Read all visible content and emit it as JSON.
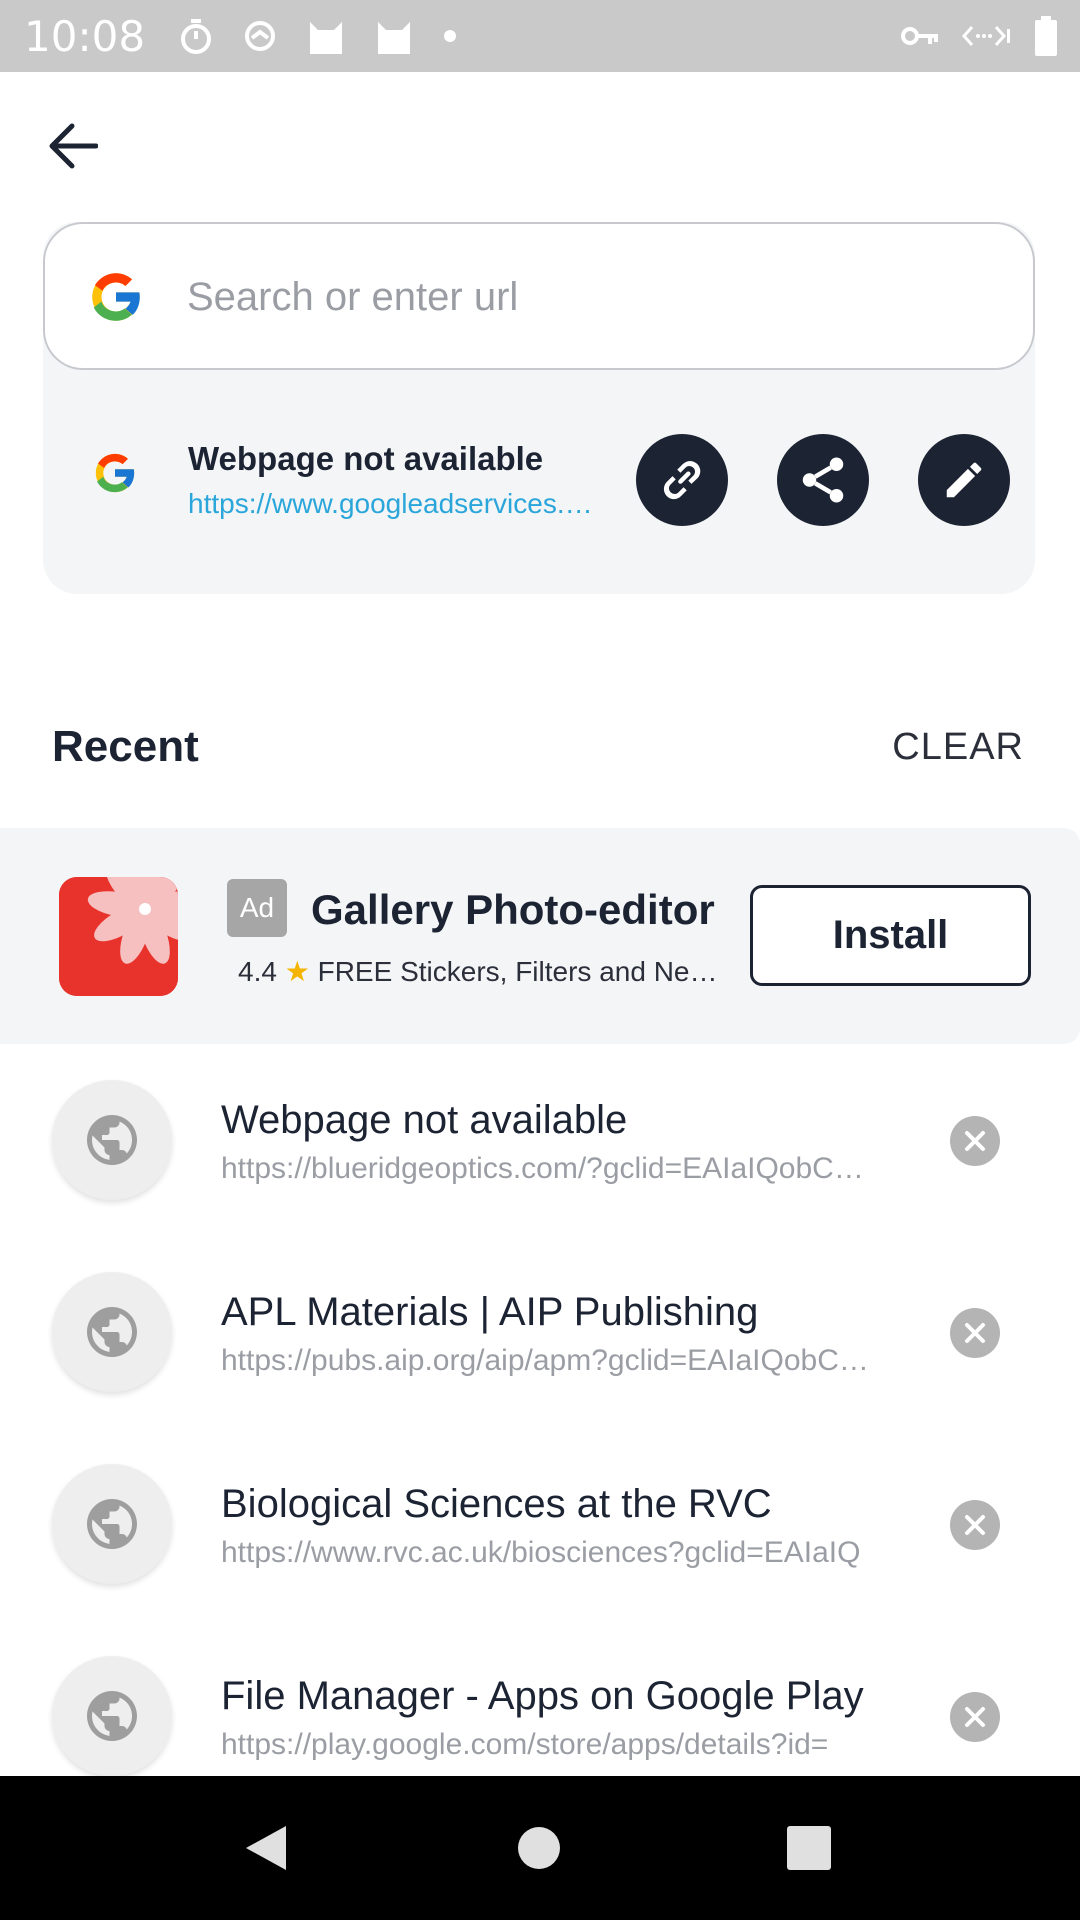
{
  "status_bar": {
    "time": "10:08",
    "left_icons": [
      "timer-icon",
      "sync-icon",
      "cat-icon",
      "cat-icon",
      "dot-icon"
    ],
    "right_icons": [
      "vpn-key-icon",
      "data-arrows-icon",
      "battery-icon"
    ]
  },
  "header": {
    "back_icon": "arrow-left-icon"
  },
  "search": {
    "placeholder": "Search or enter url",
    "value": ""
  },
  "current_page": {
    "title": "Webpage not available",
    "url": "https://www.googleadservices.com/pagead/aclk",
    "actions": [
      "link-icon",
      "share-icon",
      "edit-icon"
    ]
  },
  "recent": {
    "title": "Recent",
    "clear_label": "CLEAR"
  },
  "ad": {
    "badge": "Ad",
    "title": "Gallery Photo-editor",
    "rating": "4.4",
    "subtitle": "FREE Stickers, Filters and New Features",
    "install_label": "Install"
  },
  "recent_items": [
    {
      "title": "Webpage not available",
      "url": "https://blueridgeoptics.com/?gclid=EAIaIQobChMI"
    },
    {
      "title": "APL Materials | AIP Publishing",
      "url": "https://pubs.aip.org/aip/apm?gclid=EAIaIQobChMI"
    },
    {
      "title": "Biological Sciences at the RVC",
      "url": "https://www.rvc.ac.uk/biosciences?gclid=EAIaIQ"
    },
    {
      "title": "File Manager - Apps on Google Play",
      "url": "https://play.google.com/store/apps/details?id="
    }
  ],
  "colors": {
    "accent_dark": "#1c2333",
    "url_blue": "#2aa6da",
    "card_bg": "#f4f5f7",
    "status_bar_bg": "#c9c9c9"
  }
}
